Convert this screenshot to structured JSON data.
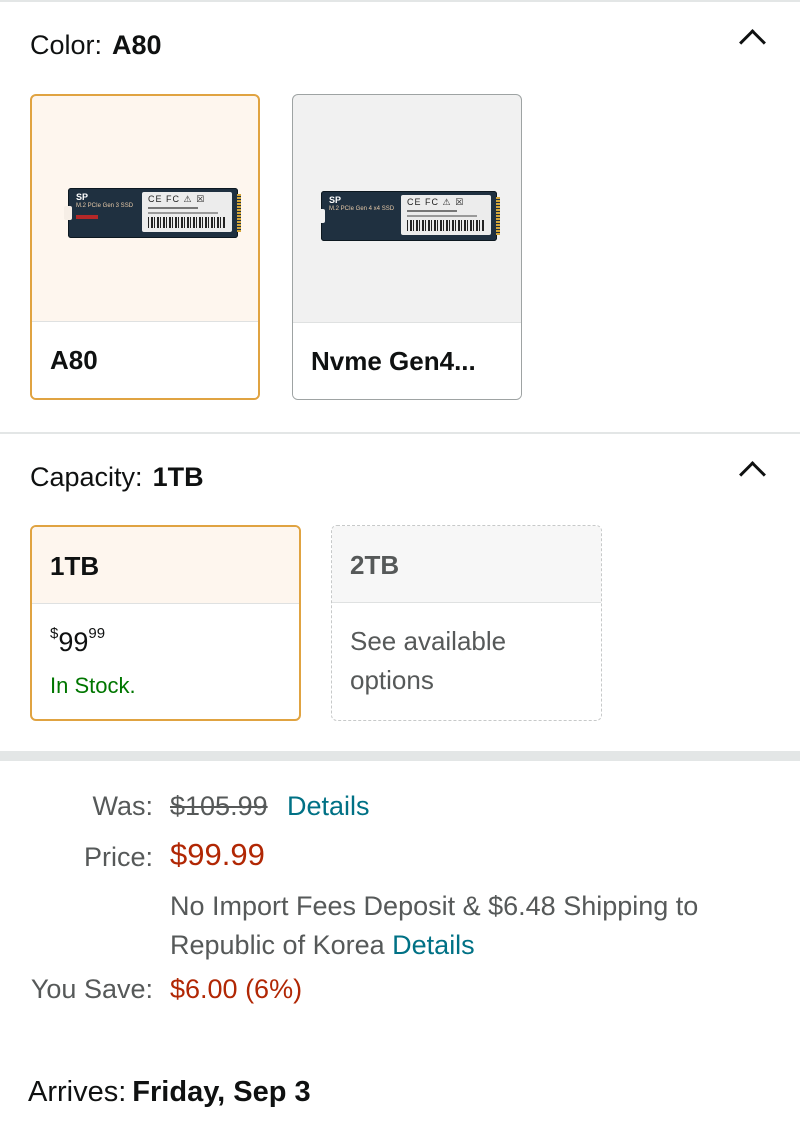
{
  "color_section": {
    "label": "Color:",
    "selected": "A80",
    "options": [
      {
        "label": "A80",
        "image_icon": "ssd-a80-image"
      },
      {
        "label": "Nvme Gen4...",
        "image_icon": "ssd-gen4-image"
      }
    ]
  },
  "ssd_a80": {
    "brand": "SP",
    "sub": "M.2 PCIe Gen 3 SSD",
    "marks": "CE FC ⚠ ☒"
  },
  "ssd_gen4": {
    "brand": "SP",
    "sub": "M.2 PCIe Gen 4 x4 SSD",
    "marks": "CE FC ⚠ ☒"
  },
  "capacity_section": {
    "label": "Capacity:",
    "selected": "1TB",
    "options": [
      {
        "label": "1TB",
        "price_symbol": "$",
        "price_whole": "99",
        "price_fraction": "99",
        "stock": "In Stock."
      },
      {
        "label": "2TB",
        "note": "See available options"
      }
    ]
  },
  "pricing": {
    "was_label": "Was:",
    "was_value": "$105.99",
    "was_link": "Details",
    "price_label": "Price:",
    "price_value": "$99.99",
    "shipping_text": "No Import Fees Deposit & $6.48 Shipping to Republic of Korea",
    "shipping_link": "Details",
    "save_label": "You Save:",
    "save_value": "$6.00 (6%)"
  },
  "delivery": {
    "label": "Arrives:",
    "date": "Friday, Sep 3"
  },
  "colors": {
    "selected_border": "#e0a341",
    "price_red": "#b12704",
    "link_teal": "#007185",
    "stock_green": "#007600"
  }
}
